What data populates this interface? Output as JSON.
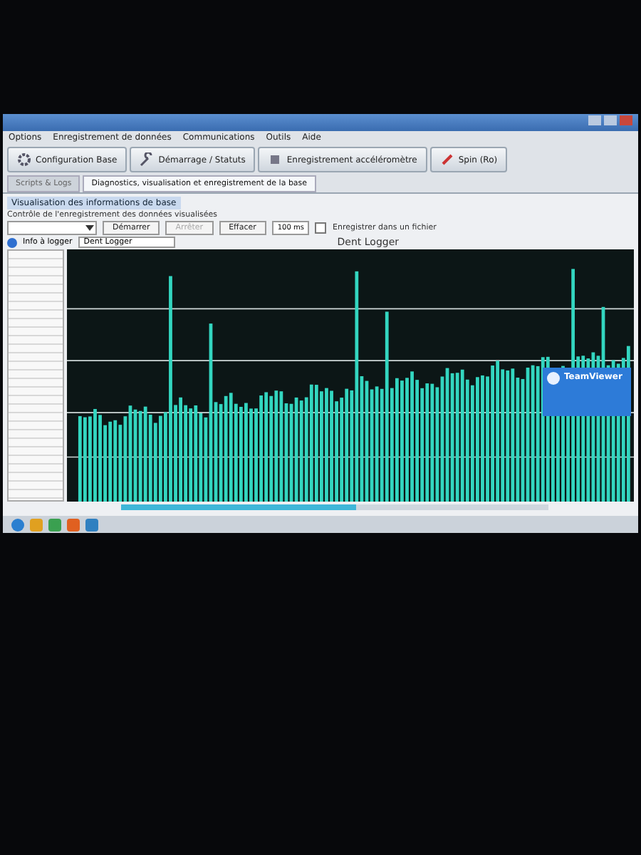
{
  "menu": [
    "Options",
    "Enregistrement de données",
    "Communications",
    "Outils",
    "Aide"
  ],
  "toolbar": [
    "Configuration Base",
    "Démarrage / Statuts",
    "Enregistrement accéléromètre",
    "Spin (Ro)"
  ],
  "tabs": [
    {
      "label": "Scripts & Logs",
      "selected": false
    },
    {
      "label": "Diagnostics, visualisation et enregistrement de la base",
      "selected": true
    }
  ],
  "panel_title": "Visualisation des informations de base",
  "control_label": "Contrôle de l'enregistrement des données visualisées",
  "buttons": [
    {
      "label": "Démarrer",
      "disabled": false
    },
    {
      "label": "Arrêter",
      "disabled": true
    },
    {
      "label": "Effacer",
      "disabled": false
    }
  ],
  "interval": "100 ms",
  "save_to_file": {
    "label": "Enregistrer dans un fichier",
    "checked": false
  },
  "info_label": "Info à logger",
  "info_value": "Dent Logger",
  "chart_title": "Dent Logger",
  "progress": {
    "level": 0.55
  },
  "popup": {
    "title": "TeamViewer"
  }
}
